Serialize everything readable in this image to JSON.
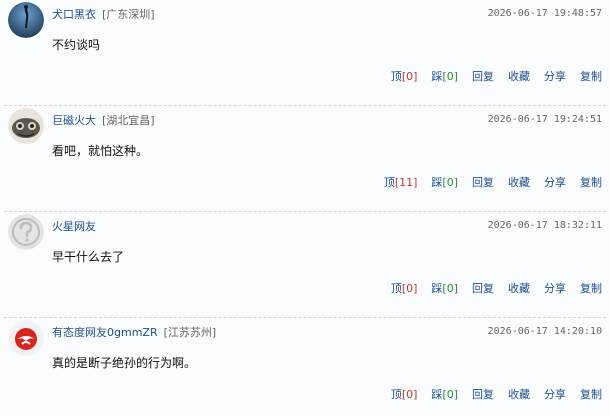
{
  "comments": [
    {
      "username": "犬口黑衣",
      "location": "[广东深圳]",
      "timestamp": "2026-06-17 19:48:57",
      "content": "不约谈吗",
      "up_label": "顶",
      "up_count": "[0]",
      "down_label": "踩",
      "down_count": "[0]",
      "reply_label": "回复",
      "fav_label": "收藏",
      "share_label": "分享",
      "copy_label": "复制"
    },
    {
      "username": "巨磁火大",
      "location": "[湖北宜昌]",
      "timestamp": "2026-06-17 19:24:51",
      "content": "看吧，就怕这种。",
      "up_label": "顶",
      "up_count": "[11]",
      "down_label": "踩",
      "down_count": "[0]",
      "reply_label": "回复",
      "fav_label": "收藏",
      "share_label": "分享",
      "copy_label": "复制"
    },
    {
      "username": "火星网友",
      "location": "",
      "timestamp": "2026-06-17 18:32:11",
      "content": "早干什么去了",
      "up_label": "顶",
      "up_count": "[0]",
      "down_label": "踩",
      "down_count": "[0]",
      "reply_label": "回复",
      "fav_label": "收藏",
      "share_label": "分享",
      "copy_label": "复制"
    },
    {
      "username": "有态度网友0gmmZR",
      "location": "[江苏苏州]",
      "timestamp": "2026-06-17 14:20:10",
      "content": "真的是断子绝孙的行为啊。",
      "up_label": "顶",
      "up_count": "[0]",
      "down_label": "踩",
      "down_count": "[0]",
      "reply_label": "回复",
      "fav_label": "收藏",
      "share_label": "分享",
      "copy_label": "复制"
    }
  ],
  "colors": {
    "link": "#1e4f8f",
    "up_count": "#c0392b",
    "down_count": "#2e8b3a"
  }
}
